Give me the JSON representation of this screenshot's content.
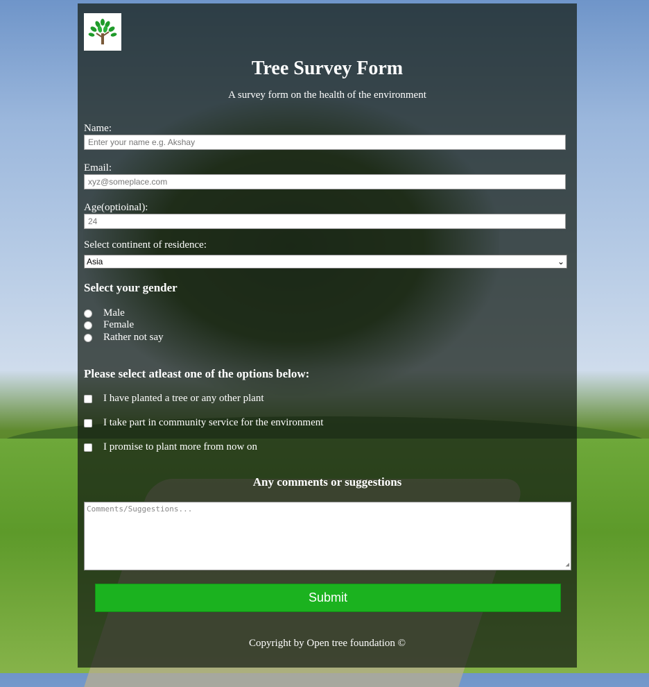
{
  "form": {
    "title": "Tree Survey Form",
    "subtitle": "A survey form on the health of the environment",
    "logo_icon": "tree-icon",
    "name_label": "Name:",
    "name_placeholder": "Enter your name e.g. Akshay",
    "email_label": "Email:",
    "email_placeholder": "xyz@someplace.com",
    "age_label": "Age(optioinal):",
    "age_placeholder": "24",
    "continent_label": "Select continent of residence:",
    "continent_selected": "Asia",
    "gender_heading": "Select your gender",
    "gender_options": [
      "Male",
      "Female",
      "Rather not say"
    ],
    "options_heading": "Please select atleast one of the options below:",
    "checkbox_options": [
      "I have planted a tree or any other plant",
      "I take part in community service for the environment",
      "I promise to plant more from now on"
    ],
    "comments_heading": "Any comments or suggestions",
    "comments_placeholder": "Comments/Suggestions...",
    "submit_label": "Submit",
    "footer": "Copyright by Open tree foundation ©"
  },
  "colors": {
    "submit_bg": "#1bb21f",
    "panel_bg": "rgba(20,28,20,0.72)"
  }
}
